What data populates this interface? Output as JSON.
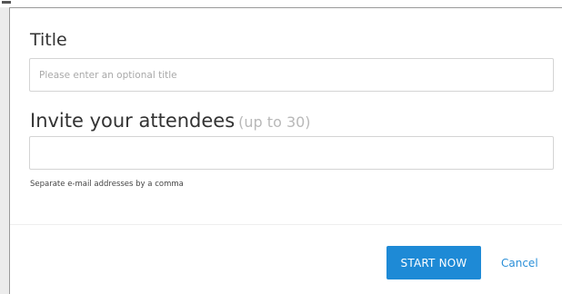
{
  "dialog": {
    "title_section": {
      "heading": "Title",
      "placeholder": "Please enter an optional title",
      "value": ""
    },
    "attendees_section": {
      "heading": "Invite your attendees",
      "hint": "(up to 30)",
      "placeholder": "",
      "value": "",
      "helper": "Separate e-mail addresses by a comma"
    },
    "actions": {
      "start_label": "START NOW",
      "cancel_label": "Cancel"
    }
  },
  "colors": {
    "primary": "#1e8ad6",
    "link": "#2a8fd8",
    "heading": "#333333",
    "hint": "#b8b8b8",
    "border": "#d4d4d4"
  }
}
